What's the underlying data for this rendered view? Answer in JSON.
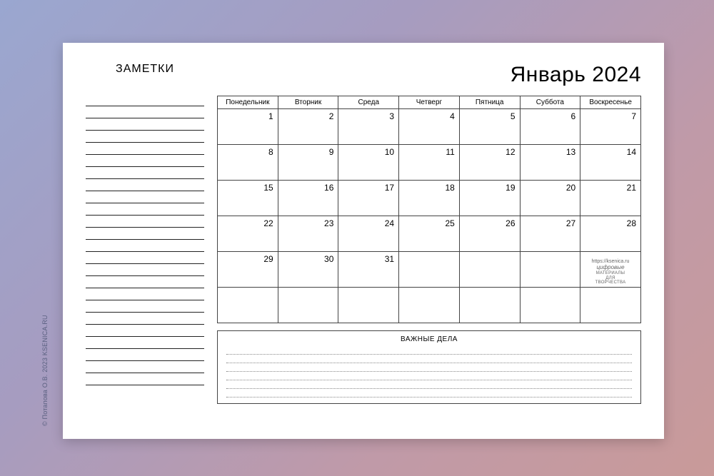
{
  "notes_title": "ЗАМЕТКИ",
  "month_title": "Январь 2024",
  "weekdays": [
    "Понедельник",
    "Вторник",
    "Среда",
    "Четверг",
    "Пятница",
    "Суббота",
    "Воскресенье"
  ],
  "weeks": [
    [
      "1",
      "2",
      "3",
      "4",
      "5",
      "6",
      "7"
    ],
    [
      "8",
      "9",
      "10",
      "11",
      "12",
      "13",
      "14"
    ],
    [
      "15",
      "16",
      "17",
      "18",
      "19",
      "20",
      "21"
    ],
    [
      "22",
      "23",
      "24",
      "25",
      "26",
      "27",
      "28"
    ],
    [
      "29",
      "30",
      "31",
      "",
      "",
      "",
      ""
    ],
    [
      "",
      "",
      "",
      "",
      "",
      "",
      ""
    ]
  ],
  "tasks_title": "ВАЖНЫЕ ДЕЛА",
  "stamp": {
    "url": "https://ksenica.ru",
    "brand": "цифровые",
    "line2": "МАТЕРИАЛЫ",
    "line3": "ДЛЯ",
    "line4": "ТВОРЧЕСТВА"
  },
  "copyright": "© Потапова О.В. 2023 KSENICA.RU",
  "note_lines": 24,
  "task_lines": 6
}
